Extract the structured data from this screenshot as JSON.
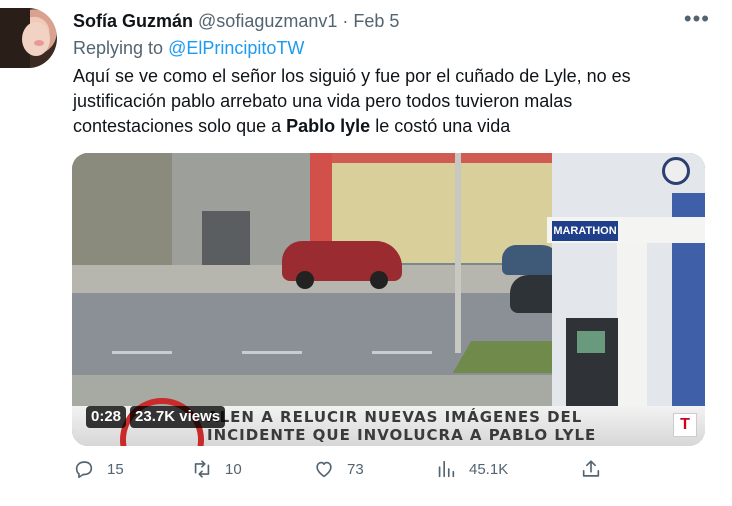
{
  "tweet": {
    "author_name": "Sofía Guzmán",
    "author_handle": "@sofiaguzmanv1",
    "separator": " · ",
    "date": "Feb 5",
    "replying_prefix": "Replying to ",
    "replying_handle": "@ElPrincipitoTW",
    "text_part1": "Aquí se ve como el señor los siguió y fue por el cuñado de Lyle, no es justificación pablo arrebato una vida pero todos tuvieron malas contestaciones solo que a ",
    "text_bold": "Pablo lyle",
    "text_part2": " le costó una vida",
    "more_label": "•••"
  },
  "media": {
    "duration": "0:28",
    "views": "23.7K views",
    "caption_line1": "ALEN A RELUCIR NUEVAS IMÁGENES DEL",
    "caption_line2": "INCIDENTE QUE INVOLUCRA A PABLO LYLE",
    "station_sign": "MARATHON",
    "network_logo": "T"
  },
  "actions": {
    "replies": "15",
    "retweets": "10",
    "likes": "73",
    "views": "45.1K"
  },
  "icons": {
    "reply": "reply-icon",
    "retweet": "retweet-icon",
    "like": "heart-icon",
    "views": "bar-chart-icon",
    "share": "share-icon"
  },
  "colors": {
    "link": "#1d9bf0",
    "muted": "#536471",
    "text": "#0f1419"
  }
}
